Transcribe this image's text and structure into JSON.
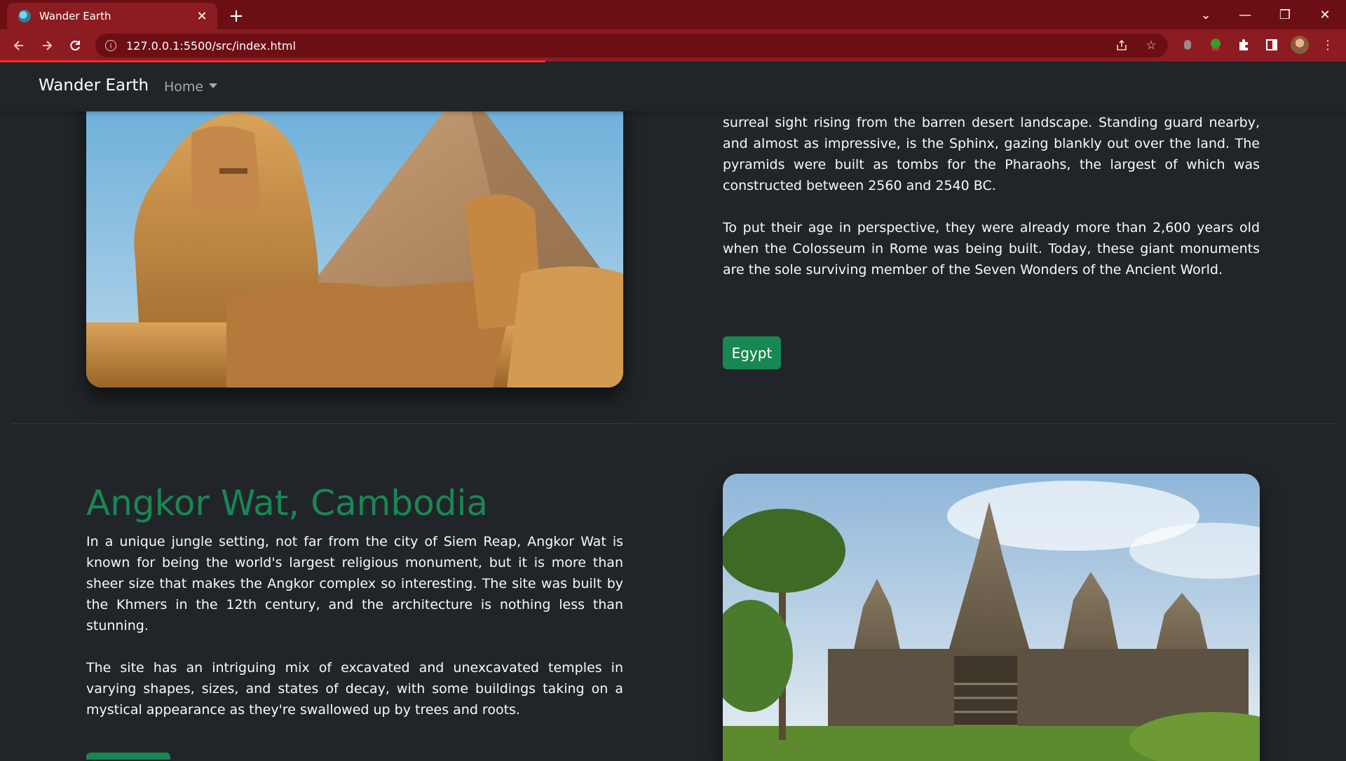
{
  "browser": {
    "tab_title": "Wander Earth",
    "tab_close": "✕",
    "new_tab": "+",
    "url": "127.0.0.1:5500/src/index.html",
    "window_controls": [
      "⌄",
      "—",
      "❐",
      "✕"
    ],
    "icons": [
      "back-arrow-icon",
      "forward-arrow-icon",
      "reload-icon",
      "site-info-icon",
      "share-icon",
      "star-icon",
      "extension-icon",
      "side-panel-icon",
      "kebab-menu-icon"
    ],
    "accent_color": "#8c1c21",
    "loading_color": "#ff2d2d"
  },
  "navbar": {
    "brand": "Wander Earth",
    "home": "Home"
  },
  "egypt": {
    "paragraphs": [
      "surreal sight rising from the barren desert landscape. Standing guard nearby, and almost as impressive, is the Sphinx, gazing blankly out over the land. The pyramids were built as tombs for the Pharaohs, the largest of which was constructed between 2560 and 2540 BC.",
      "To put their age in perspective, they were already more than 2,600 years old when the Colosseum in Rome was being built. Today, these giant monuments are the sole surviving member of the Seven Wonders of the Ancient World."
    ],
    "button": "Egypt"
  },
  "angkor": {
    "title": "Angkor Wat, Cambodia",
    "paragraphs": [
      "In a unique jungle setting, not far from the city of Siem Reap, Angkor Wat is known for being the world's largest religious monument, but it is more than sheer size that makes the Angkor complex so interesting. The site was built by the Khmers in the 12th century, and the architecture is nothing less than stunning.",
      "The site has an intriguing mix of excavated and unexcavated temples in varying shapes, sizes, and states of decay, with some buildings taking on a mystical appearance as they're swallowed up by trees and roots."
    ]
  },
  "colors": {
    "page_bg": "#212529",
    "heading_green": "#198754",
    "button_green": "#198754"
  }
}
